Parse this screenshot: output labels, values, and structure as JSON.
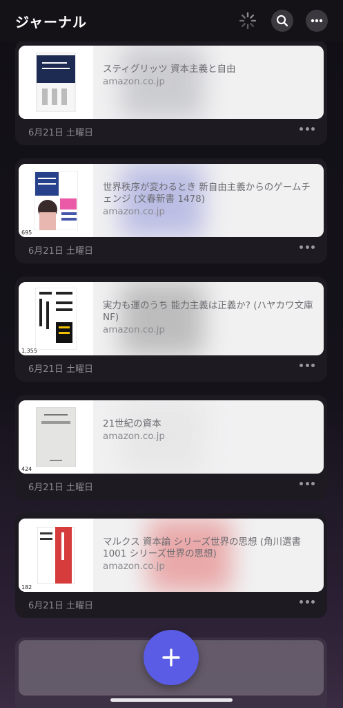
{
  "header": {
    "title": "ジャーナル",
    "icons": [
      "loading-spinner-icon",
      "search-icon",
      "more-icon"
    ]
  },
  "entries": [
    {
      "title": "スティグリッツ 資本主義と自由",
      "site": "amazon.co.jp",
      "date": "6月21日 土曜日",
      "count": "",
      "accent": "#b8b9bf"
    },
    {
      "title": "世界秩序が変わるとき 新自由主義からのゲームチェンジ (文春新書 1478)",
      "site": "amazon.co.jp",
      "date": "6月21日 土曜日",
      "count": "695",
      "accent": "#8c8fd0"
    },
    {
      "title": "実力も運のうち 能力主義は正義か? (ハヤカワ文庫NF)",
      "site": "amazon.co.jp",
      "date": "6月21日 土曜日",
      "count": "1,355",
      "accent": "#9a9a9a"
    },
    {
      "title": "21世紀の資本",
      "site": "amazon.co.jp",
      "date": "6月21日 土曜日",
      "count": "424",
      "accent": "#d9d9d9"
    },
    {
      "title": "マルクス 資本論 シリーズ世界の思想 (角川選書1001 シリーズ世界の思想)",
      "site": "amazon.co.jp",
      "date": "6月21日 土曜日",
      "count": "182",
      "accent": "#e06060"
    }
  ],
  "fab": {
    "icon": "plus-icon"
  },
  "colors": {
    "accent": "#5a5ce6",
    "background": "#121016"
  }
}
